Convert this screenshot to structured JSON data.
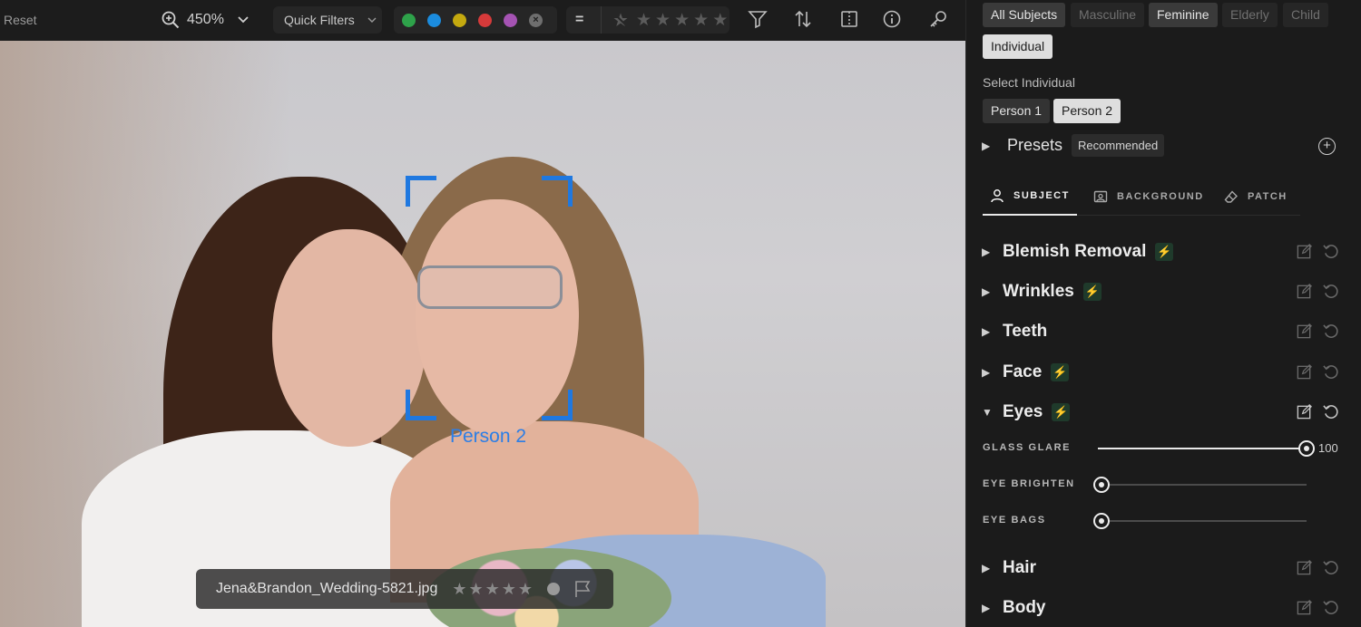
{
  "toolbar": {
    "reset_label": "Reset",
    "zoom_value": "450%",
    "quick_filters_label": "Quick Filters",
    "color_labels": [
      "#2ea24a",
      "#1b8cde",
      "#c4a90f",
      "#d63a3a",
      "#a553b3"
    ],
    "rating_eq": "="
  },
  "photo": {
    "person_tag": "Person 2",
    "filename": "Jena&Brandon_Wedding-5821.jpg",
    "stars": 5
  },
  "panel": {
    "subject_chips": [
      {
        "label": "All Subjects",
        "state": "on"
      },
      {
        "label": "Masculine",
        "state": "off"
      },
      {
        "label": "Feminine",
        "state": "on"
      },
      {
        "label": "Elderly",
        "state": "off"
      },
      {
        "label": "Child",
        "state": "off"
      },
      {
        "label": "Individual",
        "state": "sel"
      }
    ],
    "select_individual_label": "Select Individual",
    "people": [
      {
        "label": "Person 1",
        "state": "on"
      },
      {
        "label": "Person 2",
        "state": "sel"
      }
    ],
    "presets": {
      "title": "Presets",
      "badge": "Recommended"
    },
    "tabs": [
      {
        "label": "SUBJECT",
        "icon": "person-icon",
        "active": true
      },
      {
        "label": "BACKGROUND",
        "icon": "image-icon",
        "active": false
      },
      {
        "label": "PATCH",
        "icon": "eraser-icon",
        "active": false
      }
    ],
    "sections": [
      {
        "title": "Blemish Removal",
        "ai": true,
        "open": false
      },
      {
        "title": "Wrinkles",
        "ai": true,
        "open": false
      },
      {
        "title": "Teeth",
        "ai": false,
        "open": false
      },
      {
        "title": "Face",
        "ai": true,
        "open": false
      },
      {
        "title": "Eyes",
        "ai": true,
        "open": true
      },
      {
        "title": "Hair",
        "ai": false,
        "open": false
      },
      {
        "title": "Body",
        "ai": false,
        "open": false
      }
    ],
    "sliders": [
      {
        "label": "GLASS GLARE",
        "value": 100,
        "display": "100"
      },
      {
        "label": "EYE BRIGHTEN",
        "value": 0,
        "display": ""
      },
      {
        "label": "EYE BAGS",
        "value": 0,
        "display": ""
      }
    ],
    "accent_color": "#3ad47b",
    "selection_color": "#1f78e0"
  }
}
